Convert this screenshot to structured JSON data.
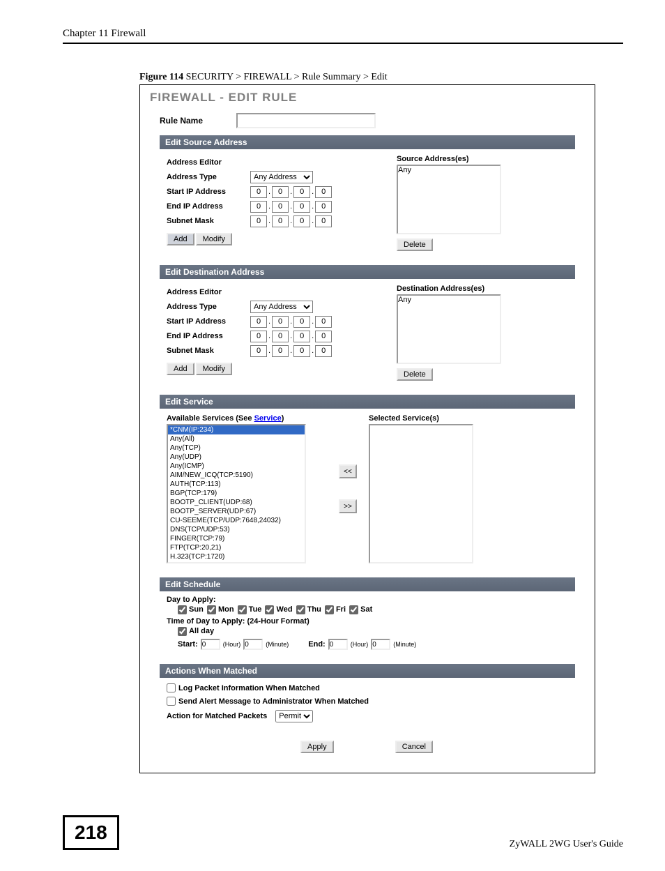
{
  "chapter": "Chapter 11 Firewall",
  "figure_num": "Figure 114",
  "figure_caption": "   SECURITY > FIREWALL > Rule Summary > Edit",
  "panel_title": "FIREWALL - EDIT RULE",
  "rulename_label": "Rule Name",
  "rulename_value": "",
  "sec_src": "Edit Source Address",
  "sec_dst": "Edit Destination Address",
  "sec_svc": "Edit Service",
  "sec_sched": "Edit Schedule",
  "sec_act": "Actions When Matched",
  "addr": {
    "editor": "Address Editor",
    "type": "Address Type",
    "type_opt": "Any Address",
    "start": "Start IP Address",
    "end": "End IP Address",
    "mask": "Subnet Mask",
    "ip": [
      "0",
      "0",
      "0",
      "0"
    ]
  },
  "btns": {
    "add": "Add",
    "modify": "Modify",
    "delete": "Delete",
    "apply": "Apply",
    "cancel": "Cancel"
  },
  "src_box_title": "Source Address(es)",
  "dst_box_title": "Destination Address(es)",
  "any": "Any",
  "svc": {
    "avail_label": "Available Services  (See ",
    "avail_link": "Service",
    "avail_label2": ")",
    "sel_label": "Selected Service(s)",
    "items": [
      "*CNM(IP:234)",
      "Any(All)",
      "Any(TCP)",
      "Any(UDP)",
      "Any(ICMP)",
      "AIM/NEW_ICQ(TCP:5190)",
      "AUTH(TCP:113)",
      "BGP(TCP:179)",
      "BOOTP_CLIENT(UDP:68)",
      "BOOTP_SERVER(UDP:67)",
      "CU-SEEME(TCP/UDP:7648,24032)",
      "DNS(TCP/UDP:53)",
      "FINGER(TCP:79)",
      "FTP(TCP:20,21)",
      "H.323(TCP:1720)"
    ],
    "move_left": "<<",
    "move_right": ">>"
  },
  "sched": {
    "day_label": "Day to Apply:",
    "days": [
      "Sun",
      "Mon",
      "Tue",
      "Wed",
      "Thu",
      "Fri",
      "Sat"
    ],
    "time_label": "Time of Day to Apply: (24-Hour Format)",
    "allday": "All day",
    "start": "Start:",
    "end": "End:",
    "hour": "(Hour)",
    "min": "(Minute)",
    "zero": "0"
  },
  "actions": {
    "log": "Log Packet Information When Matched",
    "alert": "Send Alert Message to Administrator When Matched",
    "action_label": "Action for Matched Packets",
    "action_opt": "Permit"
  },
  "page_number": "218",
  "guide": "ZyWALL 2WG User's Guide"
}
